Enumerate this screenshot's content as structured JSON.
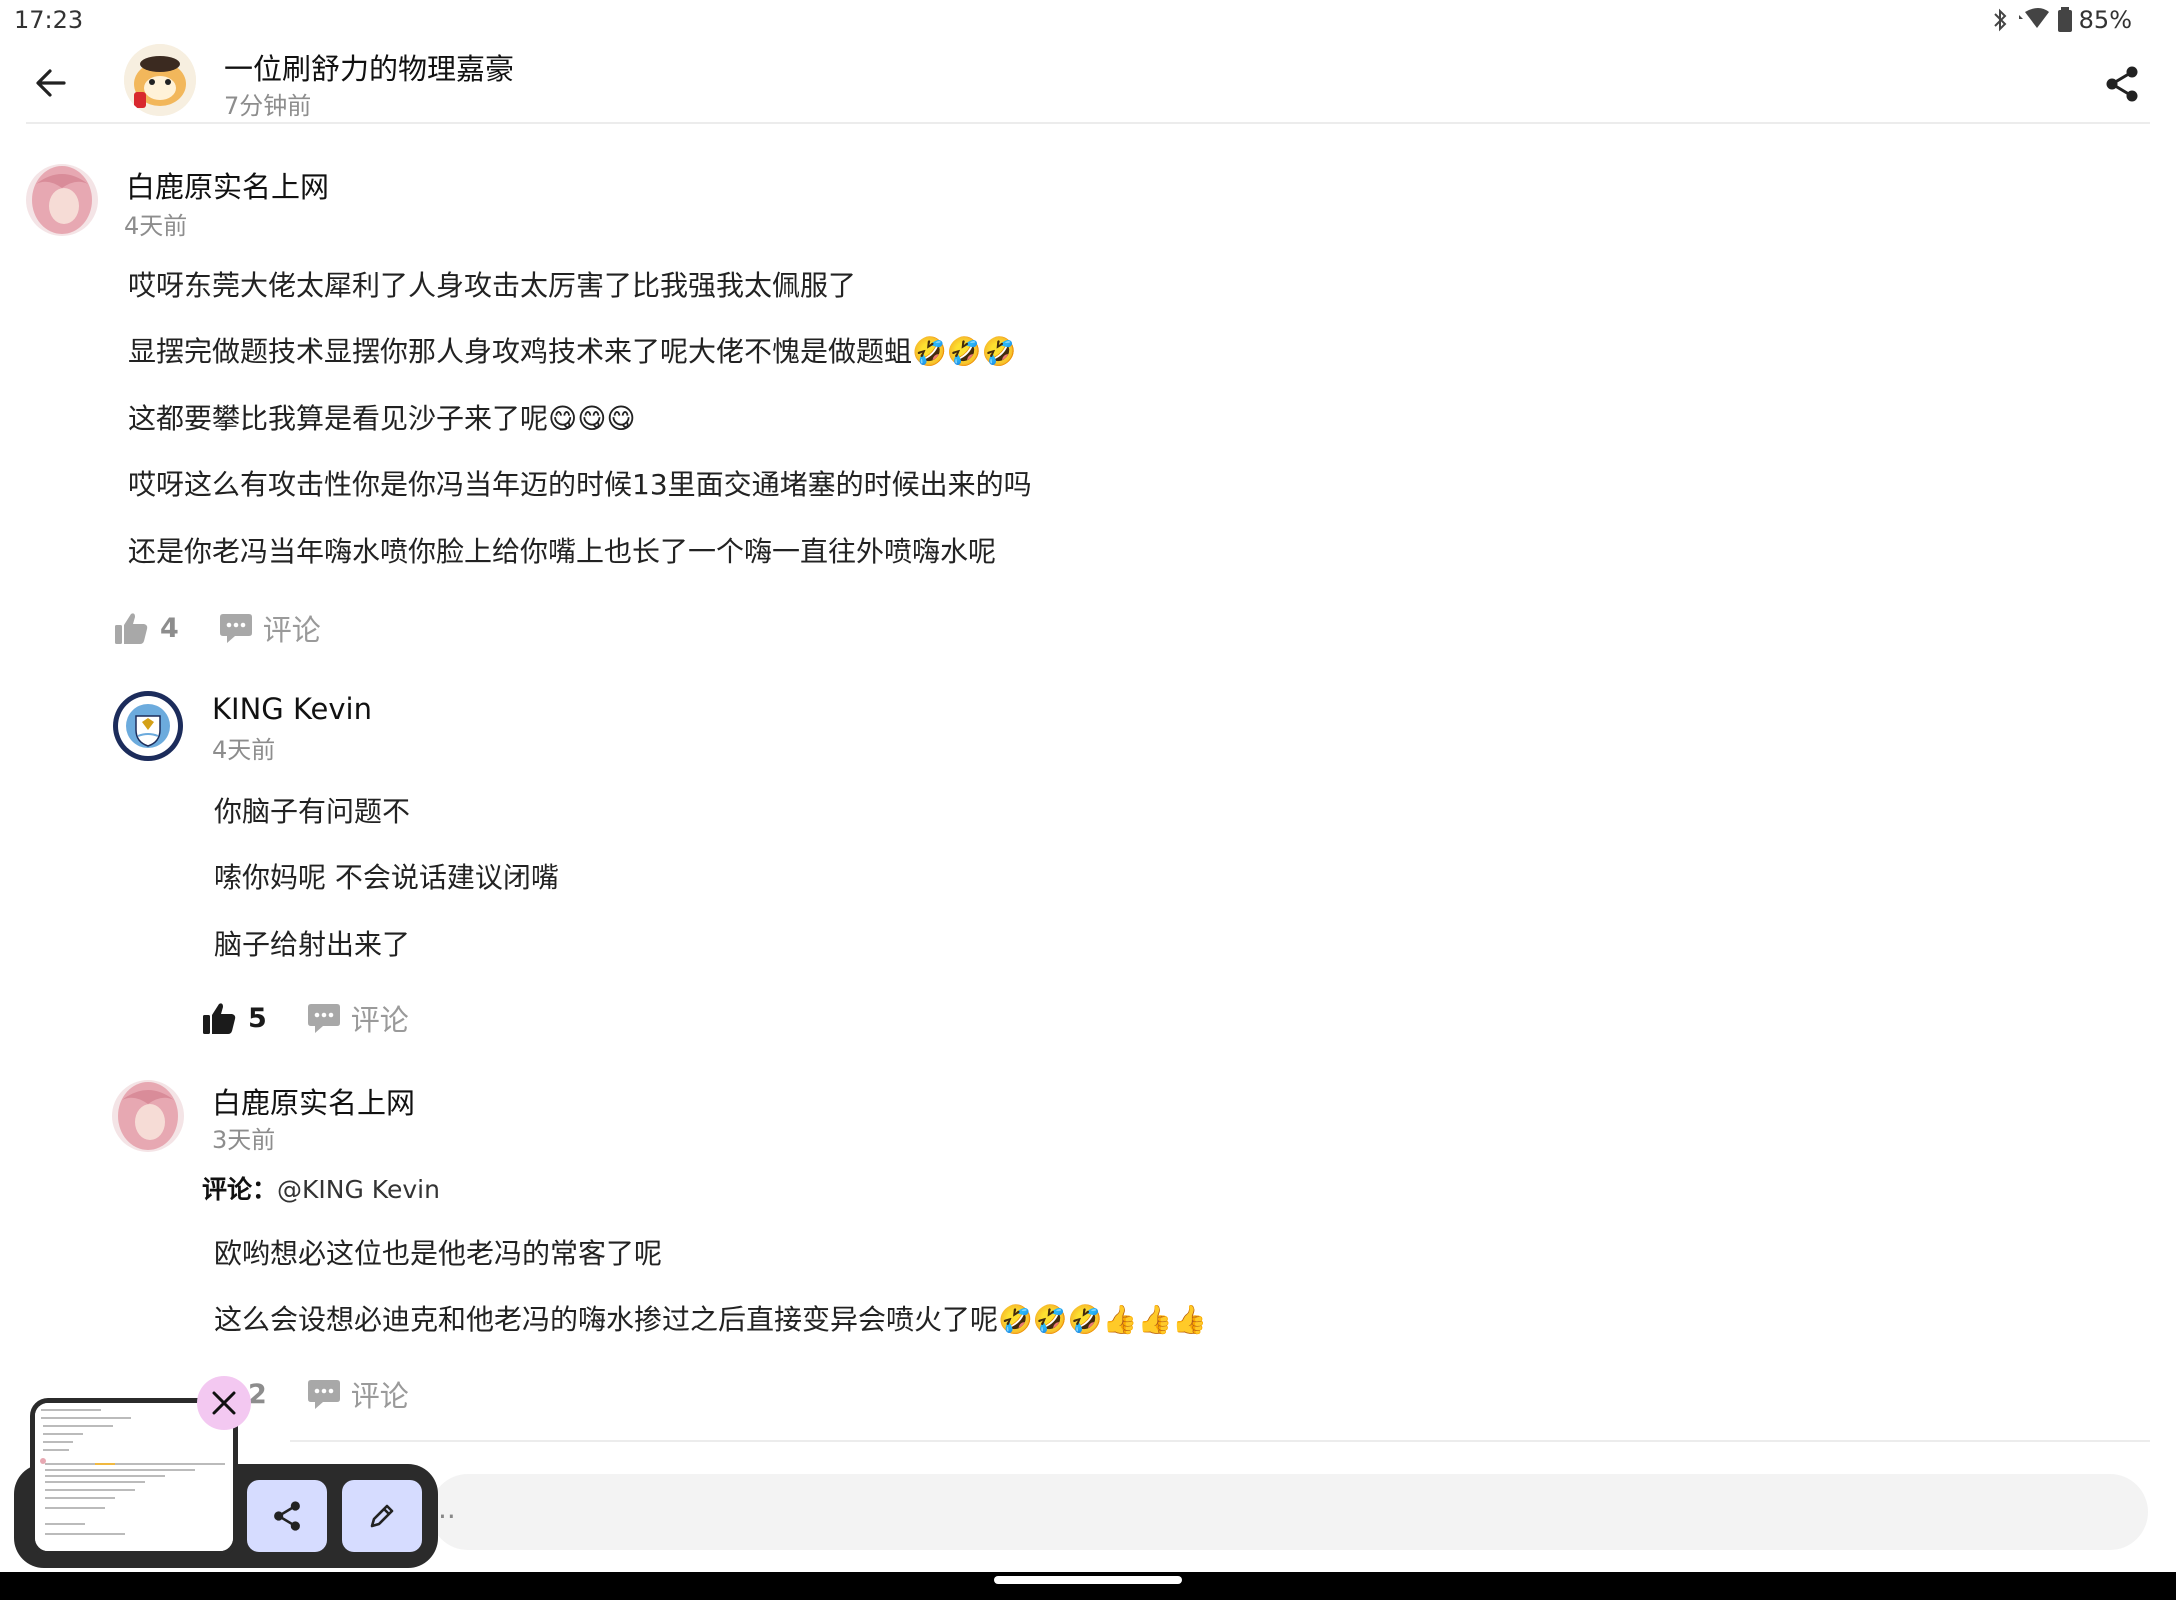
{
  "status_bar": {
    "time": "17:23",
    "battery": "85%"
  },
  "header": {
    "title": "一位刷舒力的物理嘉豪",
    "time": "7分钟前"
  },
  "comments": [
    {
      "name": "白鹿原实名上网",
      "time": "4天前",
      "lines": [
        "哎呀东莞大佬太犀利了人身攻击太厉害了比我强我太佩服了",
        "显摆完做题技术显摆你那人身攻鸡技术来了呢大佬不愧是做题蛆🤣🤣🤣",
        "这都要攀比我算是看见沙子来了呢😋😋😋",
        "哎呀这么有攻击性你是你冯当年迈的时候13里面交通堵塞的时候出来的吗",
        "还是你老冯当年嗨水喷你脸上给你嘴上也长了一个嗨一直往外喷嗨水呢"
      ],
      "likes": "4",
      "comment_label": "评论"
    },
    {
      "name": "KING Kevin",
      "time": "4天前",
      "lines": [
        "你脑子有问题不",
        "嗦你妈呢 不会说话建议闭嘴",
        "脑子给射出来了"
      ],
      "likes": "5",
      "comment_label": "评论"
    },
    {
      "name": "白鹿原实名上网",
      "time": "3天前",
      "reply_prefix": "评论：",
      "reply_target": "@KING Kevin",
      "lines": [
        "欧哟想必这位也是他老冯的常客了呢",
        "这么会设想必迪克和他老冯的嗨水掺过之后直接变异会喷火了呢🤣🤣🤣👍👍👍"
      ],
      "likes": "2",
      "comment_label": "评论"
    }
  ],
  "input": {
    "placeholder": ".."
  },
  "icons": {
    "back": "arrow-left-icon",
    "share": "share-icon",
    "like": "thumbs-up-icon",
    "comment": "comment-bubble-icon",
    "bluetooth": "bluetooth-icon",
    "wifi": "wifi-icon",
    "battery": "battery-icon",
    "close": "close-icon",
    "edit": "pencil-icon"
  },
  "colors": {
    "accent_close": "#f3c8f1",
    "tool_button": "#d6dcff",
    "muted_text": "#8d8d8d"
  }
}
